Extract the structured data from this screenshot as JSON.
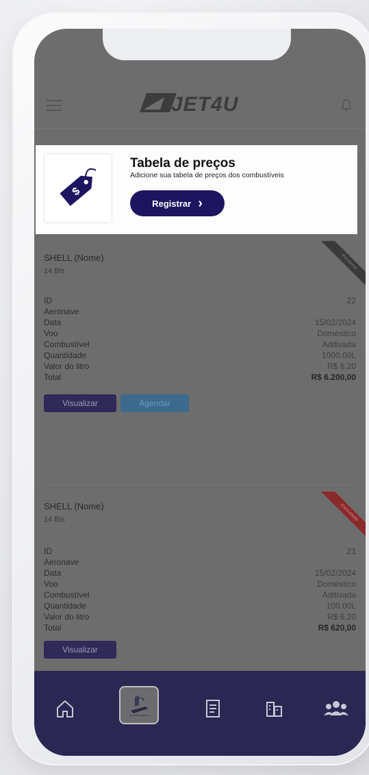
{
  "app": {
    "logo_text": "JET4U"
  },
  "header": {
    "menu_icon": "hamburger-icon",
    "notification_icon": "bell-icon"
  },
  "promo": {
    "title": "Tabela de preços",
    "subtitle": "Adicione sua tabela de preços dos combustíveis",
    "button_label": "Registrar",
    "button_chevron": "›",
    "icon": "price-tag-icon"
  },
  "fuel_cards": [
    {
      "supplier": "SHELL (Nome)",
      "subtitle": "14 Bis",
      "status": "Pendente",
      "labels": [
        "ID",
        "Aeronave",
        "Data",
        "Voo",
        "Combustível",
        "Quantidade",
        "Valor do litro",
        "Total"
      ],
      "values": [
        "22",
        "",
        "15/02/2024",
        "Doméstico",
        "Aditivada",
        "1000.00L",
        "R$ 6,20",
        "R$ 6.200,00"
      ],
      "buttons": {
        "view": "Visualizar",
        "schedule": "Agendar"
      }
    },
    {
      "supplier": "SHELL (Nome)",
      "subtitle": "14 Bis",
      "status": "Cancelado",
      "labels": [
        "ID",
        "Aeronave",
        "Data",
        "Voo",
        "Combustível",
        "Quantidade",
        "Valor do litro",
        "Total"
      ],
      "values": [
        "21",
        "",
        "15/02/2024",
        "Doméstico",
        "Aditivada",
        "100.00L",
        "R$ 6,20",
        "R$ 620,00"
      ],
      "buttons": {
        "view": "Visualizar"
      }
    }
  ],
  "bottom_nav": {
    "items": [
      "home-icon",
      "fuel-plane-icon",
      "document-icon",
      "buildings-icon",
      "users-group-icon"
    ],
    "active_index": 1
  },
  "colors": {
    "brand_navy": "#1d1560",
    "nav_bg": "#2a2753",
    "danger": "#8a2a2a"
  }
}
